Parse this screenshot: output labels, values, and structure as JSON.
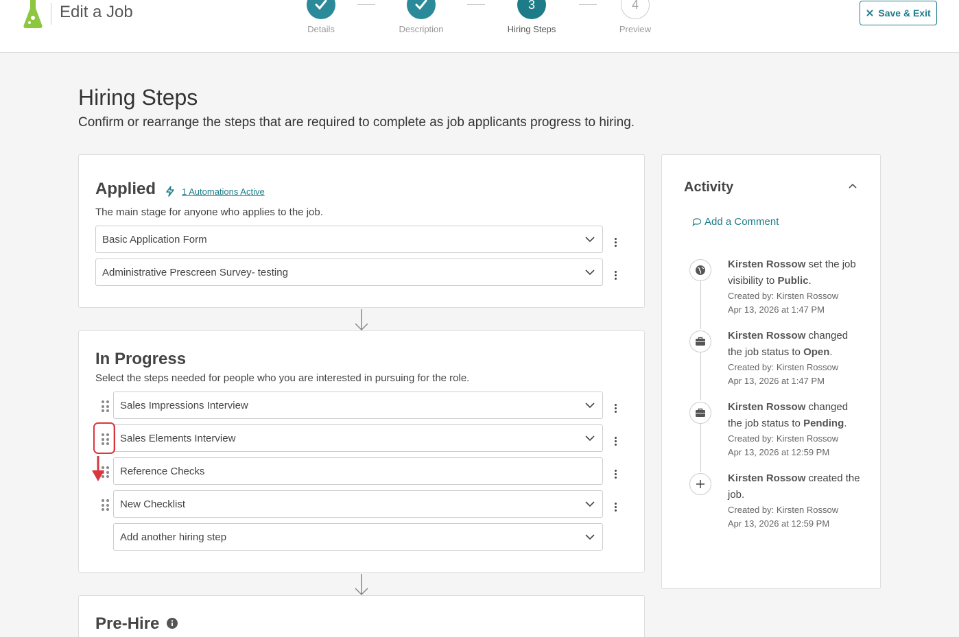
{
  "header": {
    "title": "Edit a Job",
    "steps": [
      {
        "number": "1",
        "label": "Details",
        "state": "done"
      },
      {
        "number": "2",
        "label": "Description",
        "state": "done"
      },
      {
        "number": "3",
        "label": "Hiring Steps",
        "state": "active"
      },
      {
        "number": "4",
        "label": "Preview",
        "state": "todo"
      }
    ],
    "save_exit_label": "Save & Exit"
  },
  "main": {
    "title": "Hiring Steps",
    "subtitle": "Confirm or rearrange the steps that are required to complete as job applicants progress to hiring."
  },
  "applied": {
    "title": "Applied",
    "automation_link": "1 Automations Active",
    "description": "The main stage for anyone who applies to the job.",
    "steps": [
      "Basic Application Form",
      "Administrative Prescreen Survey- testing"
    ]
  },
  "in_progress": {
    "title": "In Progress",
    "description": "Select the steps needed for people who you are interested in pursuing for the role.",
    "steps": [
      "Sales Impressions Interview",
      "Sales Elements Interview",
      "Reference Checks",
      "New Checklist"
    ],
    "add_step_placeholder": "Add another hiring step"
  },
  "pre_hire": {
    "title": "Pre-Hire"
  },
  "activity": {
    "title": "Activity",
    "add_comment_label": "Add a Comment",
    "items": [
      {
        "icon": "globe-icon",
        "actor": "Kirsten Rossow",
        "action": " set the job visibility to ",
        "value": "Public",
        "end": ".",
        "created_by": "Created by: Kirsten Rossow",
        "timestamp": "Apr 13, 2026 at 1:47 PM"
      },
      {
        "icon": "briefcase-icon",
        "actor": "Kirsten Rossow",
        "action": " changed the job status to ",
        "value": "Open",
        "end": ".",
        "created_by": "Created by: Kirsten Rossow",
        "timestamp": "Apr 13, 2026 at 1:47 PM"
      },
      {
        "icon": "briefcase-icon",
        "actor": "Kirsten Rossow",
        "action": " changed the job status to ",
        "value": "Pending",
        "end": ".",
        "created_by": "Created by: Kirsten Rossow",
        "timestamp": "Apr 13, 2026 at 12:59 PM"
      },
      {
        "icon": "plus-icon",
        "actor": "Kirsten Rossow",
        "action": " created the job.",
        "value": "",
        "end": "",
        "created_by": "Created by: Kirsten Rossow",
        "timestamp": "Apr 13, 2026 at 12:59 PM"
      }
    ]
  },
  "colors": {
    "accent": "#1d7c88",
    "logo": "#8dc63f",
    "highlight": "#d9363e"
  }
}
